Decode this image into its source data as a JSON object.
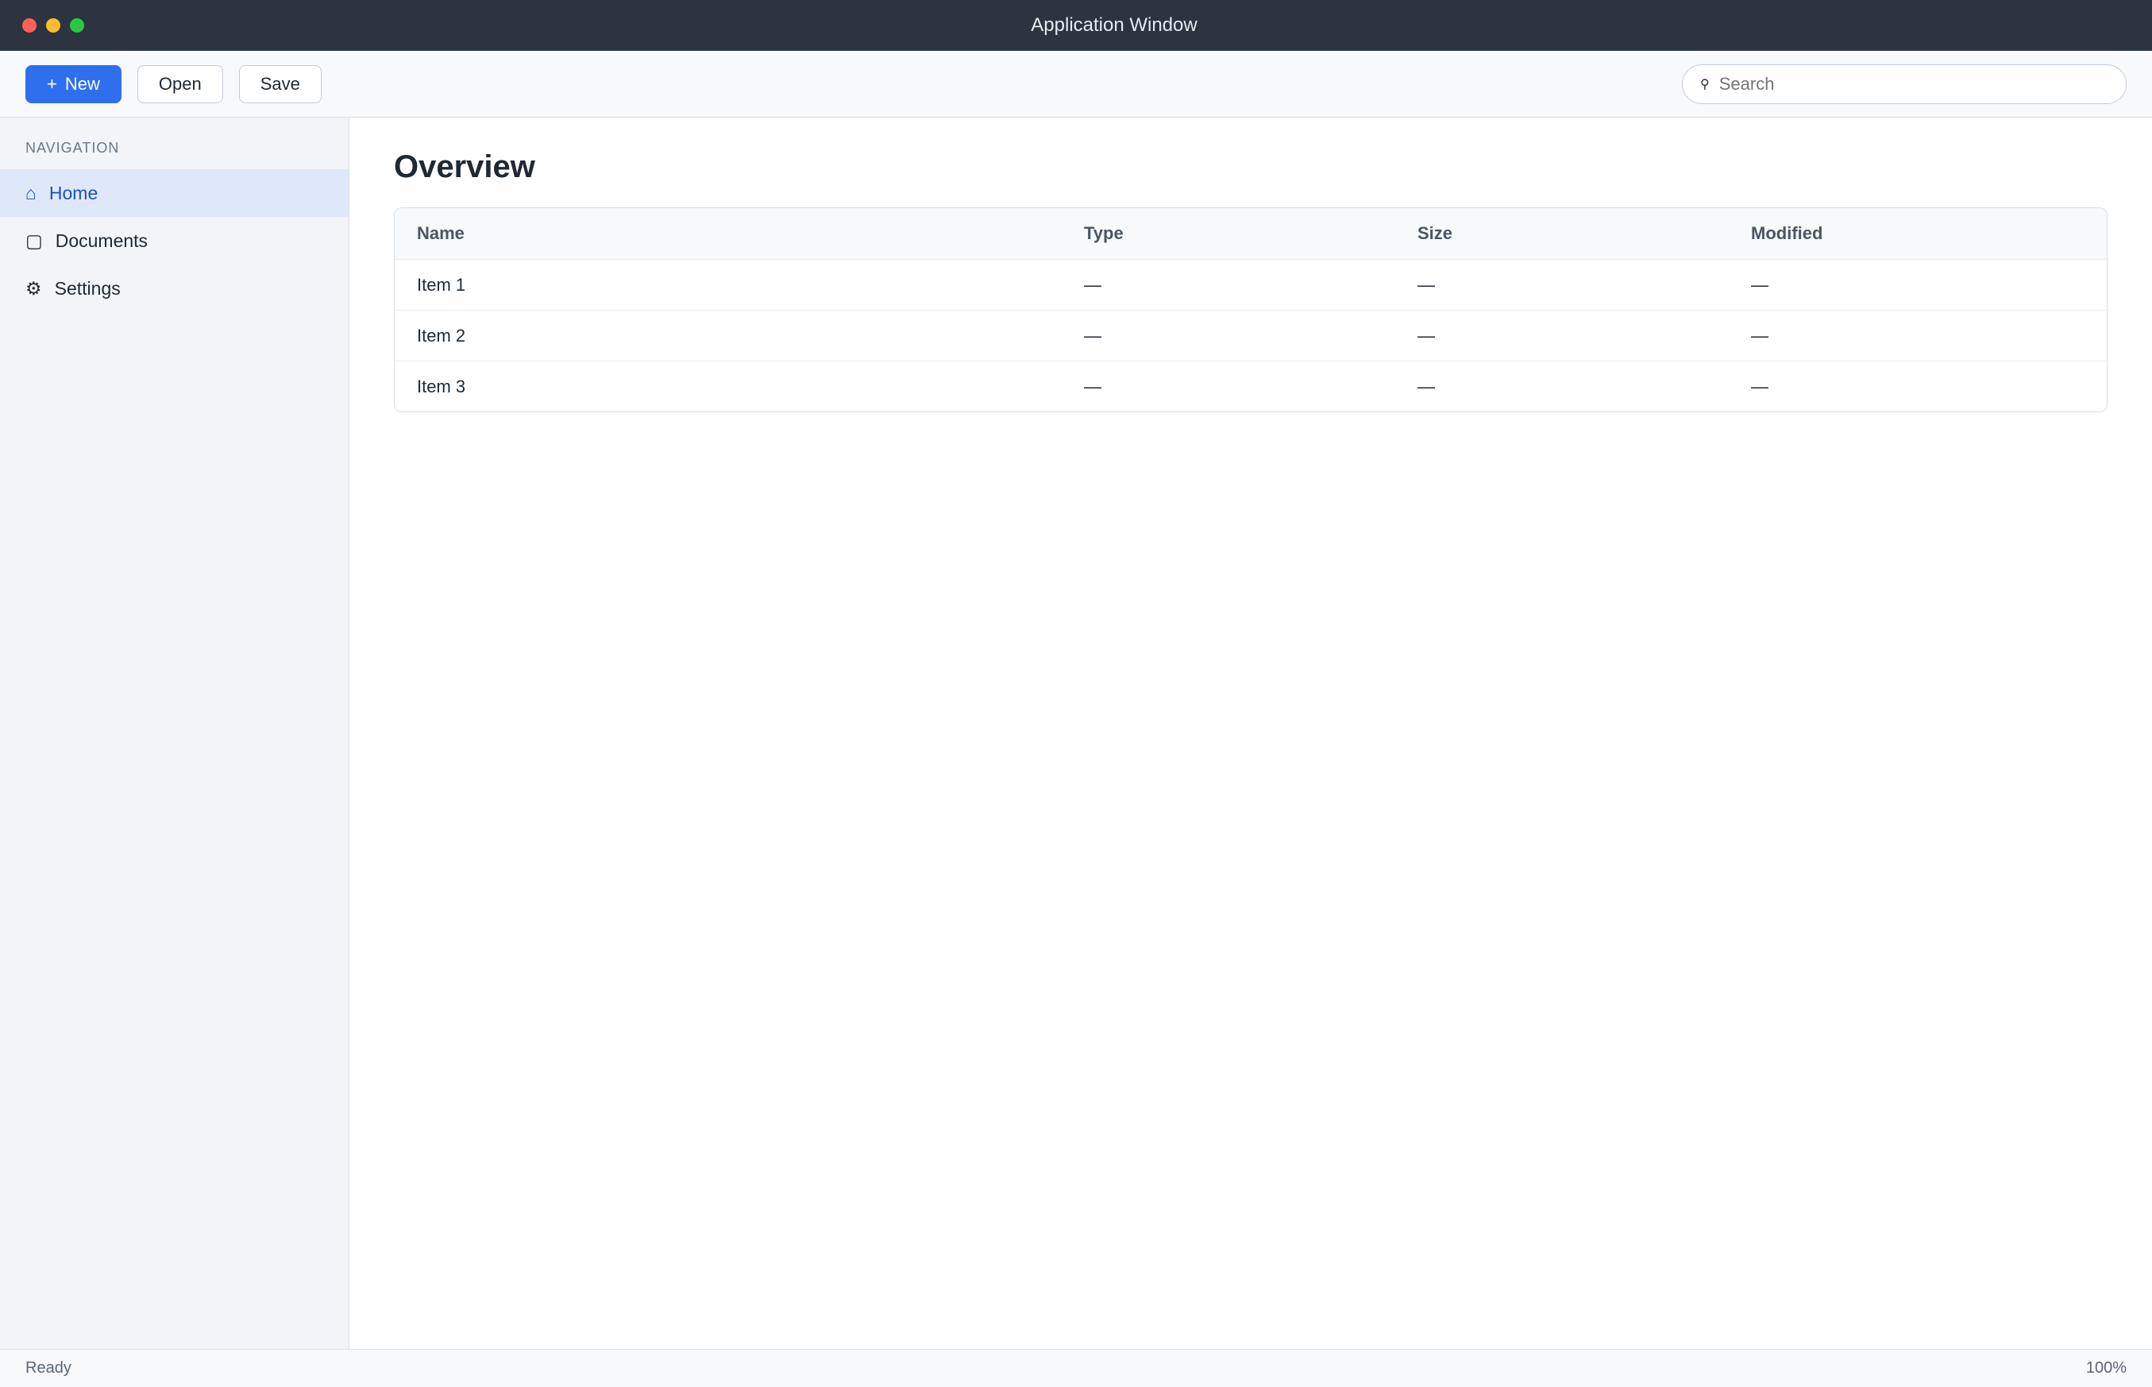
{
  "window": {
    "title": "Application Window"
  },
  "toolbar": {
    "new_label": "New",
    "open_label": "Open",
    "save_label": "Save",
    "search_placeholder": "Search"
  },
  "sidebar": {
    "heading": "NAVIGATION",
    "items": [
      {
        "label": "Home",
        "icon": "home-icon"
      },
      {
        "label": "Documents",
        "icon": "folder-icon"
      },
      {
        "label": "Settings",
        "icon": "gear-icon"
      }
    ]
  },
  "main": {
    "page_title": "Overview",
    "columns": [
      "Name",
      "Type",
      "Size",
      "Modified"
    ],
    "rows": [
      [
        "Item 1",
        "—",
        "—",
        "—"
      ],
      [
        "Item 2",
        "—",
        "—",
        "—"
      ],
      [
        "Item 3",
        "—",
        "—",
        "—"
      ]
    ]
  },
  "status": {
    "left": "Ready",
    "right": "100%"
  }
}
